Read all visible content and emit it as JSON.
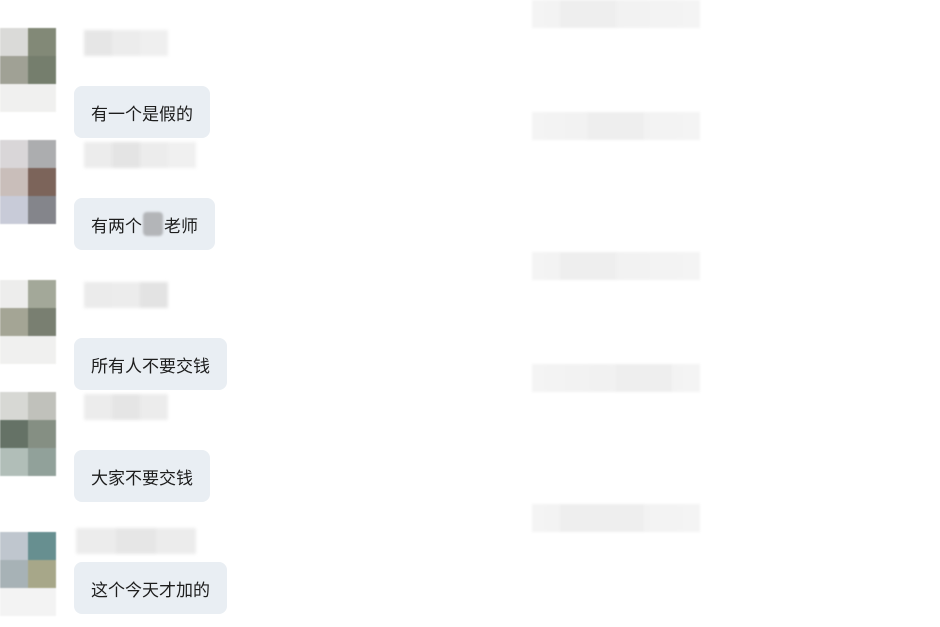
{
  "messages": [
    {
      "text": "有一个是假的",
      "avatar_colors": [
        "#d9d9d6",
        "#7c8370",
        "#9b9c90",
        "#6e7866",
        "#f0f0ef",
        "#f0f0ef"
      ]
    },
    {
      "text_before": "有两个",
      "text_after": "老师",
      "avatar_colors": [
        "#d7d4d6",
        "#a8a9ab",
        "#c7bbb7",
        "#755c52",
        "#c6c9d6",
        "#7e7f85"
      ]
    },
    {
      "text": "所有人不要交钱",
      "avatar_colors": [
        "#ededeb",
        "#9fa494",
        "#a0a190",
        "#72796a",
        "#f0f0ef",
        "#f0f0ef"
      ]
    },
    {
      "text": "大家不要交钱",
      "avatar_colors": [
        "#d5d6d2",
        "#bdbeb8",
        "#5d6b5e",
        "#7f8a7d",
        "#adbbb5",
        "#8c9c95"
      ]
    },
    {
      "text": "这个今天才加的",
      "avatar_colors": [
        "#bcc4cc",
        "#5f8a8b",
        "#a3aeb3",
        "#a3a383",
        "#f3f3f3",
        "#f3f3f3"
      ]
    }
  ]
}
